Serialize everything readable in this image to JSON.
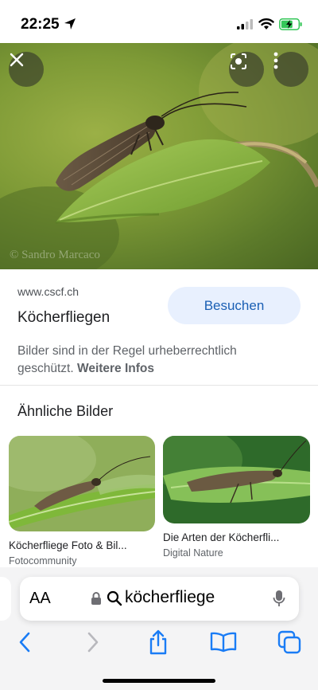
{
  "status_bar": {
    "time": "22:25"
  },
  "hero": {
    "watermark": "© Sandro Marcaco"
  },
  "result": {
    "source": "www.cscf.ch",
    "title": "Köcherfliegen",
    "visit_label": "Besuchen",
    "copyright_text": "Bilder sind in der Regel urheberrechtlich geschützt.",
    "more_info": "Weitere Infos"
  },
  "similar": {
    "heading": "Ähnliche Bilder",
    "items": [
      {
        "title": "Köcherfliege Foto & Bil...",
        "source": "Fotocommunity"
      },
      {
        "title": "Die Arten der Köcherfli...",
        "source": "Digital Nature"
      }
    ]
  },
  "browser": {
    "aa_label": "AA",
    "url_text": "köcherfliege"
  },
  "colors": {
    "accent": "#1a5fb4",
    "visit_bg": "#e8f0fe",
    "battery": "#35c759"
  }
}
